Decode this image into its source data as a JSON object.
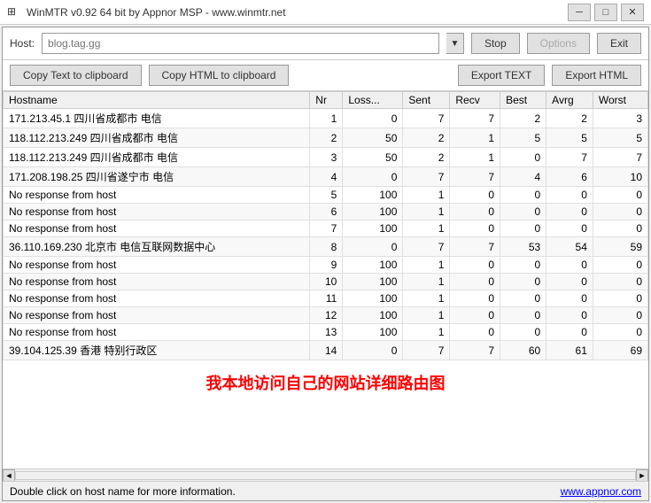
{
  "titlebar": {
    "title": "WinMTR v0.92 64 bit by Appnor MSP - www.winmtr.net",
    "icon": "⊞",
    "min_label": "─",
    "max_label": "□",
    "close_label": "✕"
  },
  "host_row": {
    "host_label": "Host:",
    "host_placeholder": "blog.tag.gg",
    "dropdown_icon": "▼",
    "stop_label": "Stop",
    "options_label": "Options",
    "exit_label": "Exit"
  },
  "clipboard_row": {
    "copy_text_label": "Copy Text to clipboard",
    "copy_html_label": "Copy HTML to clipboard",
    "export_text_label": "Export TEXT",
    "export_html_label": "Export HTML"
  },
  "table": {
    "columns": [
      "Hostname",
      "Nr",
      "Loss...",
      "Sent",
      "Recv",
      "Best",
      "Avrg",
      "Worst"
    ],
    "rows": [
      [
        "171.213.45.1 四川省成都市 电信",
        "1",
        "0",
        "7",
        "7",
        "2",
        "2",
        "3"
      ],
      [
        "118.112.213.249 四川省成都市 电信",
        "2",
        "50",
        "2",
        "1",
        "5",
        "5",
        "5"
      ],
      [
        "118.112.213.249 四川省成都市 电信",
        "3",
        "50",
        "2",
        "1",
        "0",
        "7",
        "7"
      ],
      [
        "171.208.198.25 四川省遂宁市 电信",
        "4",
        "0",
        "7",
        "7",
        "4",
        "6",
        "10"
      ],
      [
        "No response from host",
        "5",
        "100",
        "1",
        "0",
        "0",
        "0",
        "0"
      ],
      [
        "No response from host",
        "6",
        "100",
        "1",
        "0",
        "0",
        "0",
        "0"
      ],
      [
        "No response from host",
        "7",
        "100",
        "1",
        "0",
        "0",
        "0",
        "0"
      ],
      [
        "36.110.169.230 北京市 电信互联网数据中心",
        "8",
        "0",
        "7",
        "7",
        "53",
        "54",
        "59"
      ],
      [
        "No response from host",
        "9",
        "100",
        "1",
        "0",
        "0",
        "0",
        "0"
      ],
      [
        "No response from host",
        "10",
        "100",
        "1",
        "0",
        "0",
        "0",
        "0"
      ],
      [
        "No response from host",
        "11",
        "100",
        "1",
        "0",
        "0",
        "0",
        "0"
      ],
      [
        "No response from host",
        "12",
        "100",
        "1",
        "0",
        "0",
        "0",
        "0"
      ],
      [
        "No response from host",
        "13",
        "100",
        "1",
        "0",
        "0",
        "0",
        "0"
      ],
      [
        "39.104.125.39 香港 特别行政区",
        "14",
        "0",
        "7",
        "7",
        "60",
        "61",
        "69"
      ]
    ]
  },
  "annotation": {
    "text": "我本地访问自己的网站详细路由图"
  },
  "scrollbar": {
    "left_icon": "◄",
    "right_icon": "►"
  },
  "statusbar": {
    "message": "Double click on host name for more information.",
    "link": "www.appnor.com"
  }
}
